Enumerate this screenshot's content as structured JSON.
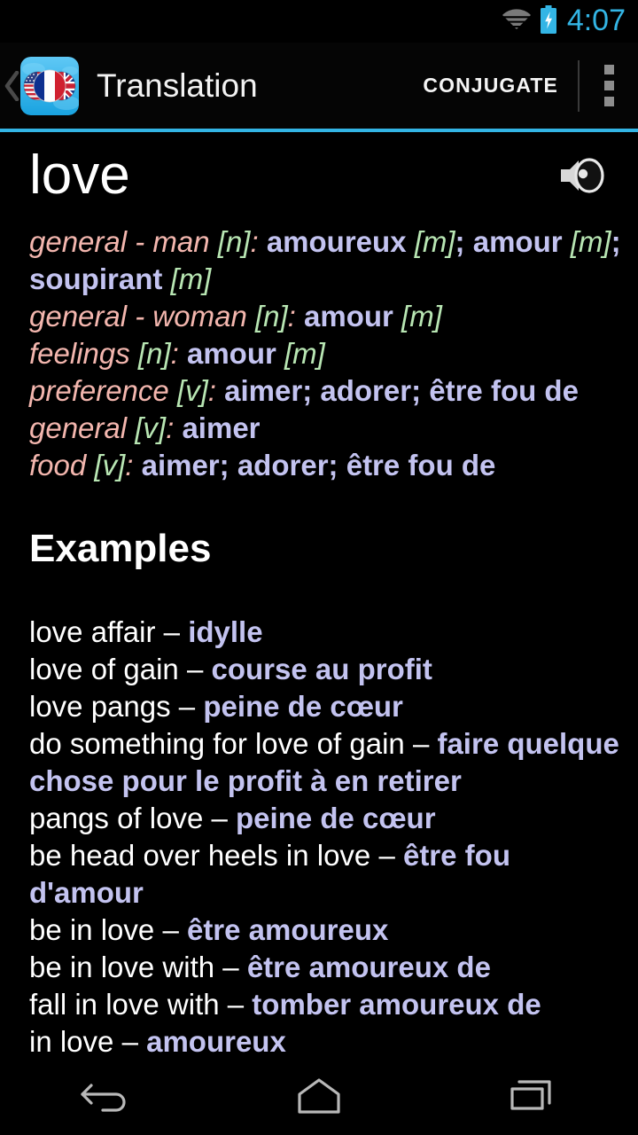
{
  "status_bar": {
    "time": "4:07",
    "wifi_icon": "wifi-icon",
    "battery_icon": "battery-charging-icon",
    "accent_color": "#33b5e5"
  },
  "action_bar": {
    "up_icon": "up-chevron-icon",
    "app_icon": "flags-app-icon",
    "title": "Translation",
    "action_label": "CONJUGATE",
    "overflow_icon": "overflow-menu-icon",
    "accent_color": "#33b5e5"
  },
  "entry": {
    "headword": "love",
    "speaker_icon": "speaker-icon"
  },
  "senses": [
    {
      "category": "general - man",
      "pos": "[n]",
      "translations": "amoureux [m]; amour [m]; soupirant [m]",
      "parts": [
        {
          "t": "tr",
          "v": "amoureux "
        },
        {
          "t": "gen",
          "v": "[m]"
        },
        {
          "t": "semi",
          "v": "; "
        },
        {
          "t": "tr",
          "v": "amour "
        },
        {
          "t": "gen",
          "v": "[m]"
        },
        {
          "t": "semi",
          "v": "; "
        },
        {
          "t": "tr",
          "v": "soupirant "
        },
        {
          "t": "gen",
          "v": "[m]"
        }
      ]
    },
    {
      "category": "general - woman",
      "pos": "[n]",
      "translations": "amour [m]",
      "parts": [
        {
          "t": "tr",
          "v": "amour "
        },
        {
          "t": "gen",
          "v": "[m]"
        }
      ]
    },
    {
      "category": "feelings",
      "pos": "[n]",
      "translations": "amour [m]",
      "parts": [
        {
          "t": "tr",
          "v": "amour "
        },
        {
          "t": "gen",
          "v": "[m]"
        }
      ]
    },
    {
      "category": "preference",
      "pos": "[v]",
      "translations": "aimer; adorer; être fou de",
      "parts": [
        {
          "t": "tr",
          "v": "aimer"
        },
        {
          "t": "semi",
          "v": "; "
        },
        {
          "t": "tr",
          "v": "adorer"
        },
        {
          "t": "semi",
          "v": "; "
        },
        {
          "t": "tr",
          "v": "être fou de"
        }
      ]
    },
    {
      "category": "general",
      "pos": "[v]",
      "translations": "aimer",
      "parts": [
        {
          "t": "tr",
          "v": "aimer"
        }
      ]
    },
    {
      "category": "food",
      "pos": "[v]",
      "translations": "aimer; adorer; être fou de",
      "parts": [
        {
          "t": "tr",
          "v": "aimer"
        },
        {
          "t": "semi",
          "v": "; "
        },
        {
          "t": "tr",
          "v": "adorer"
        },
        {
          "t": "semi",
          "v": "; "
        },
        {
          "t": "tr",
          "v": "être fou de"
        }
      ]
    }
  ],
  "examples_heading": "Examples",
  "examples": [
    {
      "en": "love affair",
      "dash": "–",
      "fr": "idylle"
    },
    {
      "en": "love of gain",
      "dash": "–",
      "fr": "course au profit"
    },
    {
      "en": "love pangs",
      "dash": "–",
      "fr": "peine de cœur"
    },
    {
      "en": "do something for love of gain",
      "dash": "–",
      "fr": "faire quelque chose pour le profit à en retirer"
    },
    {
      "en": "pangs of love",
      "dash": "–",
      "fr": "peine de cœur"
    },
    {
      "en": "be head over heels in love",
      "dash": "–",
      "fr": "être fou d'amour"
    },
    {
      "en": "be in love",
      "dash": "–",
      "fr": "être amoureux"
    },
    {
      "en": "be in love with",
      "dash": "–",
      "fr": "être amoureux de"
    },
    {
      "en": "fall in love with",
      "dash": "–",
      "fr": "tomber amoureux de"
    },
    {
      "en": "in love",
      "dash": "–",
      "fr": "amoureux"
    }
  ],
  "nav_bar": {
    "back_icon": "back-icon",
    "home_icon": "home-icon",
    "recents_icon": "recents-icon"
  }
}
